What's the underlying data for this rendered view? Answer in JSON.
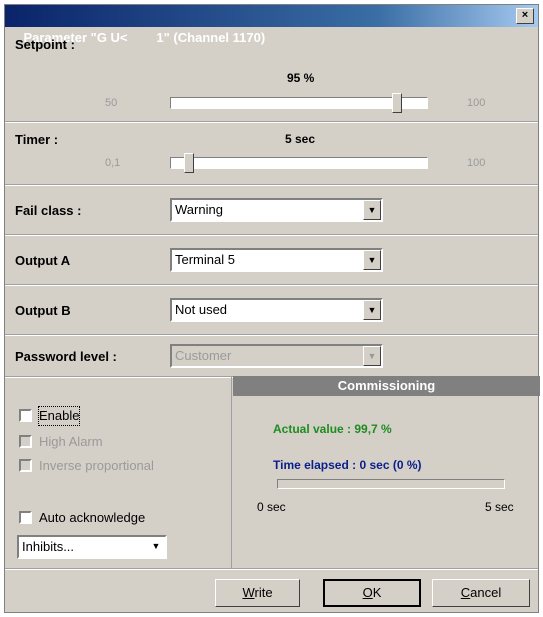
{
  "window": {
    "title": "Parameter \"G U<        1\" (Channel 1170)",
    "close_glyph": "×"
  },
  "setpoint": {
    "label": "Setpoint :",
    "value_display": "95 %",
    "min": "50",
    "max": "100",
    "level": 0.9
  },
  "timer": {
    "label": "Timer :",
    "value_display": "5 sec",
    "min": "0,1",
    "max": "100",
    "level": 0.05
  },
  "fail_class": {
    "label": "Fail class :",
    "value": "Warning"
  },
  "output_a": {
    "label": "Output A",
    "value": "Terminal 5"
  },
  "output_b": {
    "label": "Output B",
    "value": "Not used"
  },
  "password_level": {
    "label": "Password level :",
    "value": "Customer"
  },
  "checks": {
    "enable": {
      "label": "Enable",
      "checked": false,
      "disabled": false
    },
    "high_alarm": {
      "label": "High Alarm",
      "checked": false,
      "disabled": true
    },
    "inverse": {
      "label": "Inverse proportional",
      "checked": false,
      "disabled": true
    },
    "auto_ack": {
      "label": "Auto acknowledge",
      "checked": false,
      "disabled": false
    }
  },
  "inhibits": {
    "value": "Inhibits..."
  },
  "commissioning": {
    "header": "Commissioning",
    "actual_value": "Actual value : 99,7 %",
    "time_elapsed": "Time elapsed : 0 sec (0 %)",
    "progress": 0.0,
    "scale_min": "0 sec",
    "scale_max": "5 sec"
  },
  "buttons": {
    "write": {
      "pre": "",
      "accel": "W",
      "post": "rite"
    },
    "ok": {
      "pre": "",
      "accel": "O",
      "post": "K"
    },
    "cancel": {
      "pre": "",
      "accel": "C",
      "post": "ancel"
    }
  },
  "colors": {
    "actual_value": "#1e8c1e",
    "time_elapsed": "#0a1f8c",
    "title_bar": "#0a246a"
  },
  "icons": {
    "dropdown": "down-arrow-icon",
    "close": "close-icon"
  }
}
